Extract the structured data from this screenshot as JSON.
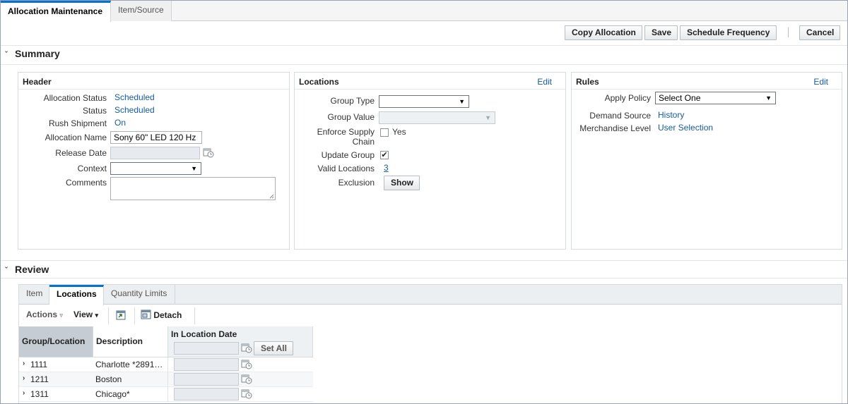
{
  "tabs": [
    {
      "label": "Allocation Maintenance",
      "active": true
    },
    {
      "label": "Item/Source",
      "active": false
    }
  ],
  "actions": {
    "copy": "Copy Allocation",
    "save": "Save",
    "schedule": "Schedule Frequency",
    "cancel": "Cancel"
  },
  "summary": {
    "title": "Summary",
    "header": {
      "title": "Header",
      "allocation_status_label": "Allocation Status",
      "allocation_status": "Scheduled",
      "status_label": "Status",
      "status": "Scheduled",
      "rush_label": "Rush Shipment",
      "rush": "On",
      "name_label": "Allocation Name",
      "name": "Sony 60\" LED 120 Hz",
      "release_label": "Release Date",
      "release": "",
      "context_label": "Context",
      "context": "",
      "comments_label": "Comments",
      "comments": ""
    },
    "locations": {
      "title": "Locations",
      "edit": "Edit",
      "group_type_label": "Group Type",
      "group_type": "",
      "group_value_label": "Group Value",
      "group_value": "",
      "enforce_label_1": "Enforce Supply",
      "enforce_label_2": "Chain",
      "enforce_yes": "Yes",
      "enforce_checked": false,
      "update_group_label": "Update Group",
      "update_group_checked": true,
      "valid_locations_label": "Valid Locations",
      "valid_locations": "3",
      "exclusion_label": "Exclusion",
      "show_button": "Show"
    },
    "rules": {
      "title": "Rules",
      "edit": "Edit",
      "apply_policy_label": "Apply Policy",
      "apply_policy": "Select One",
      "demand_source_label": "Demand Source",
      "demand_source": "History",
      "merch_level_label": "Merchandise Level",
      "merch_level": "User Selection"
    }
  },
  "review": {
    "title": "Review",
    "tabs": [
      {
        "label": "Item",
        "active": false
      },
      {
        "label": "Locations",
        "active": true
      },
      {
        "label": "Quantity Limits",
        "active": false
      }
    ],
    "toolbar": {
      "actions": "Actions",
      "view": "View",
      "detach": "Detach"
    },
    "columns": {
      "group_location": "Group/Location",
      "description": "Description",
      "in_location_date": "In Location Date",
      "set_all": "Set All"
    },
    "rows": [
      {
        "id": "1111",
        "description": "Charlotte *2891…",
        "date": ""
      },
      {
        "id": "1211",
        "description": "Boston",
        "date": ""
      },
      {
        "id": "1311",
        "description": "Chicago*",
        "date": ""
      }
    ]
  }
}
